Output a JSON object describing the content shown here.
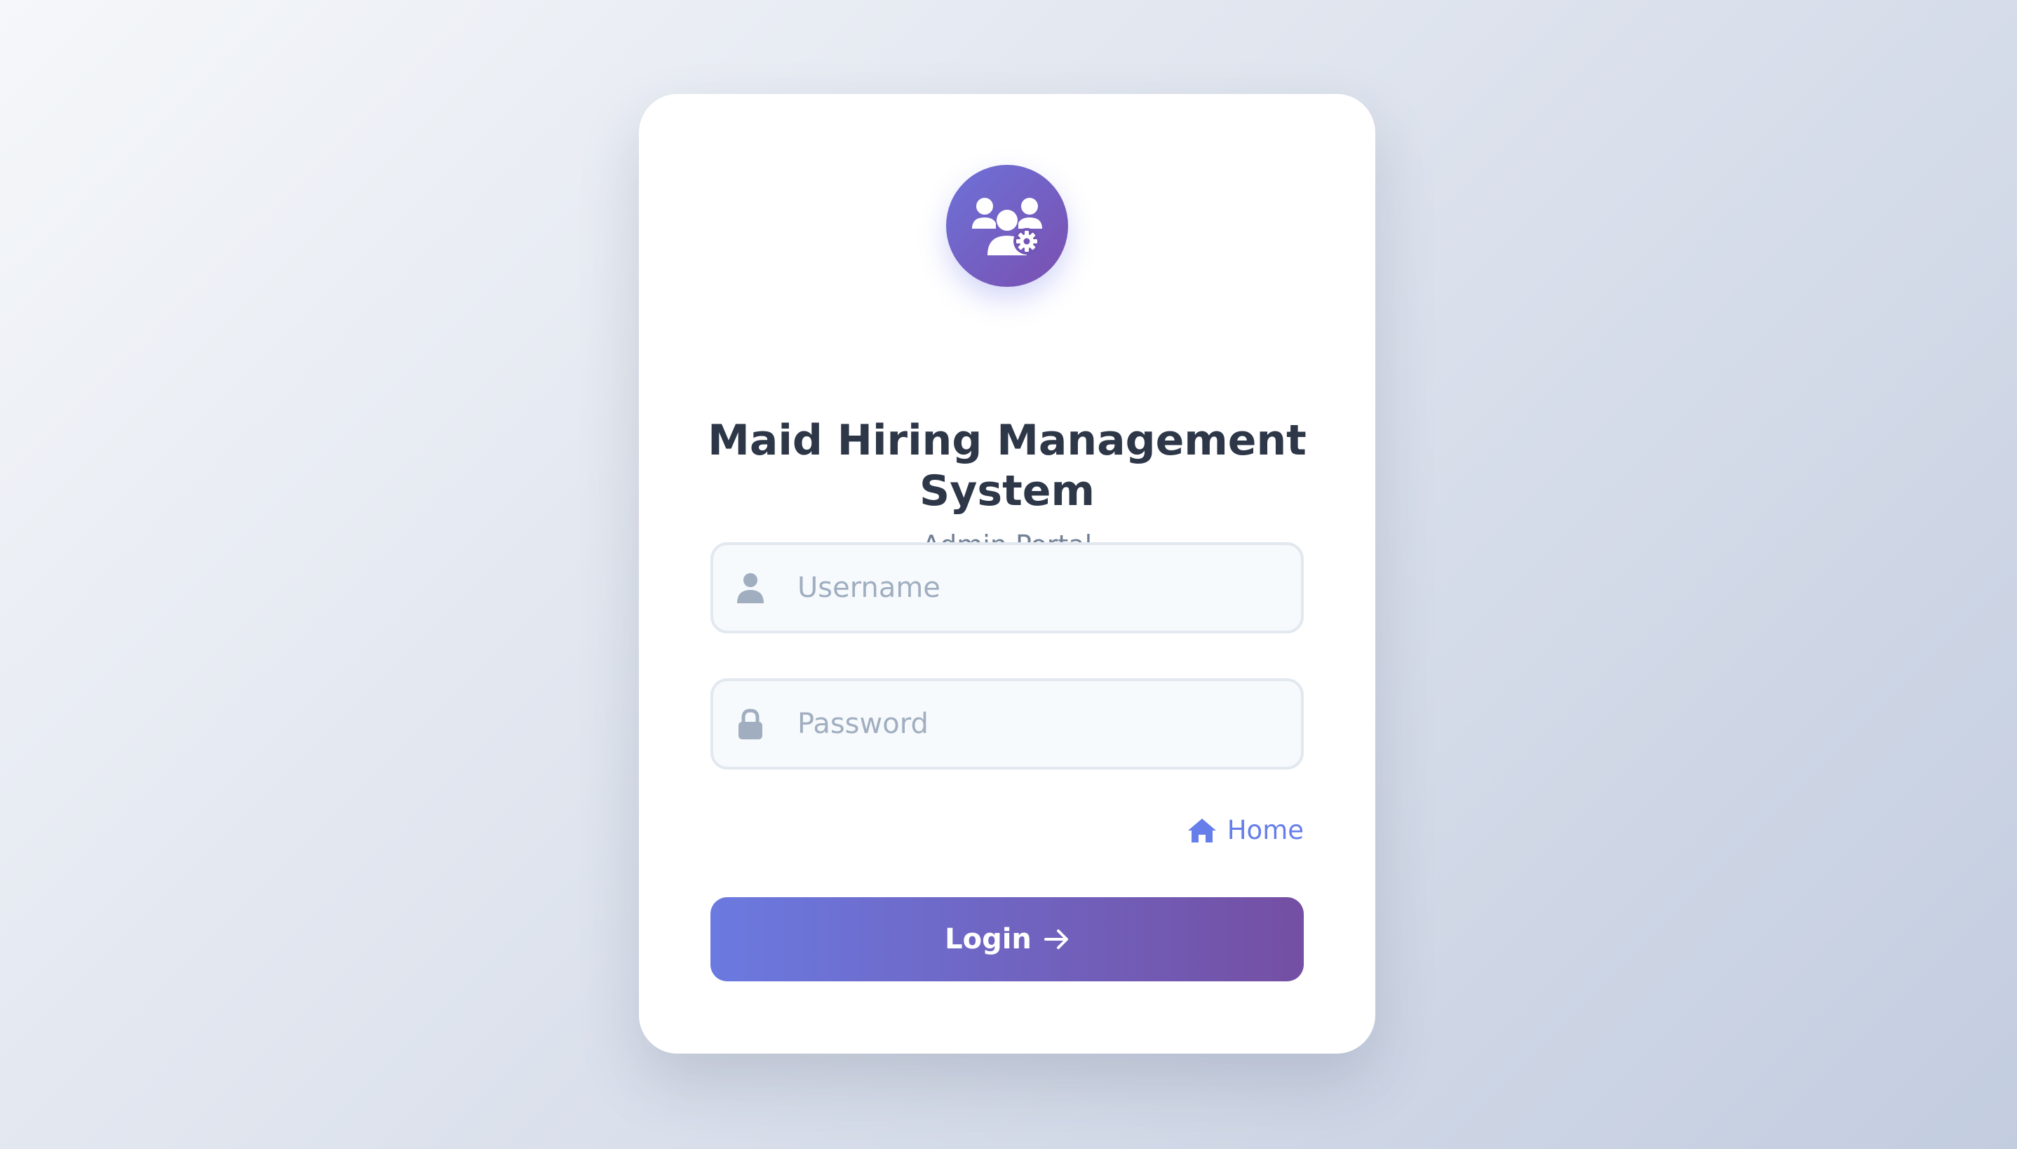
{
  "app": {
    "title": "Maid Hiring Management System",
    "subtitle": "Admin Portal",
    "logo_icon": "users-gear-icon"
  },
  "form": {
    "username": {
      "placeholder": "Username",
      "value": "",
      "icon": "user-icon"
    },
    "password": {
      "placeholder": "Password",
      "value": "",
      "icon": "lock-icon"
    },
    "home_link": {
      "label": "Home",
      "icon": "home-icon"
    },
    "login_button": {
      "label": "Login",
      "icon": "arrow-right-icon"
    }
  },
  "colors": {
    "accent": "#667eea",
    "accent_dark": "#764ba2",
    "title": "#2d3748",
    "subtitle": "#718096",
    "input_border": "#e2e8f0",
    "input_bg": "#f7fafc",
    "placeholder": "#a0aec0"
  }
}
